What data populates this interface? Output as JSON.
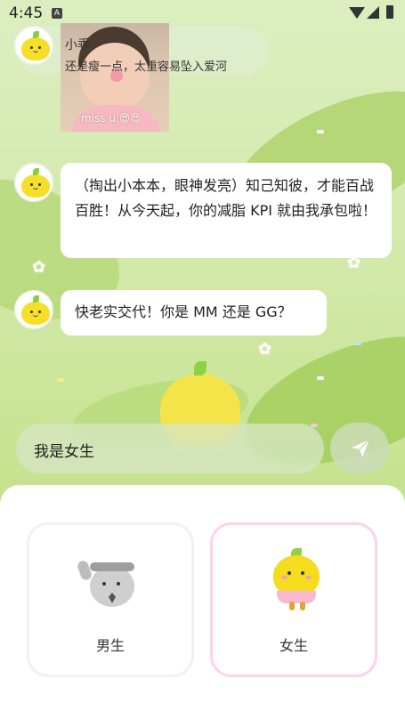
{
  "status_bar": {
    "time": "4:45",
    "notification_badge": "A"
  },
  "pinned_message": {
    "name": "小乖",
    "text": "还是瘦一点，太重容易坠入爱河",
    "photo_caption": "miss u 😍😍"
  },
  "messages": [
    {
      "sender": "bot",
      "text": "（掏出小本本，眼神发亮）知己知彼，才能百战百胜！从今天起，你的减脂 KPI 就由我承包啦！"
    },
    {
      "sender": "bot",
      "text": "快老实交代！你是 MM 还是 GG？"
    }
  ],
  "composer": {
    "value": "我是女生",
    "send_icon": "paper-plane-icon"
  },
  "gender_picker": {
    "options": [
      {
        "label": "男生",
        "selected": false
      },
      {
        "label": "女生",
        "selected": true
      }
    ],
    "selected_border_color": "#fbd3ec"
  }
}
